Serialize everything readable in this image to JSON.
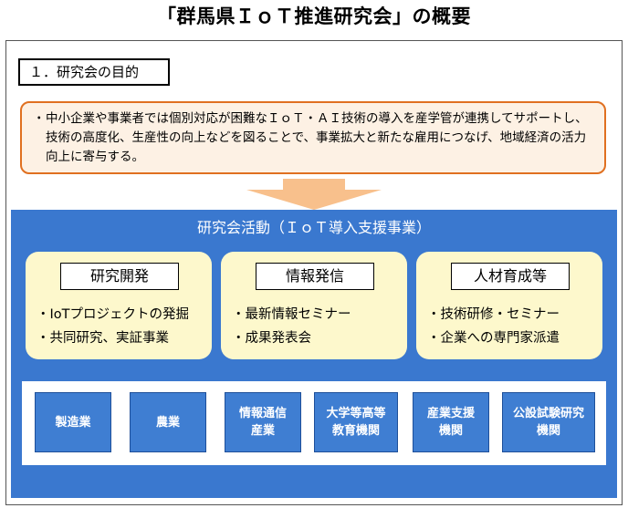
{
  "title": "「群馬県ＩｏＴ推進研究会」の概要",
  "section_label": "１．研究会の目的",
  "purpose": {
    "bullet": "・",
    "text": "中小企業や事業者では個別対応が困難なＩｏＴ・ＡＩ技術の導入を産学管が連携してサポートし、技術の高度化、生産性の向上などを図ることで、事業拡大と新たな雇用につなげ、地域経済の活力向上に寄与する。"
  },
  "activities": {
    "title": "研究会活動（ＩｏＴ導入支援事業）",
    "pillars": [
      {
        "title": "研究開発",
        "items": [
          "・IoTプロジェクトの発掘",
          "・共同研究、実証事業"
        ]
      },
      {
        "title": "情報発信",
        "items": [
          "・最新情報セミナー",
          "・成果発表会"
        ]
      },
      {
        "title": "人材育成等",
        "items": [
          "・技術研修・セミナー",
          "・企業への専門家派遣"
        ]
      }
    ],
    "sectors": [
      "製造業",
      "農業",
      "情報通信\n産業",
      "大学等高等\n教育機関",
      "産業支援\n機関",
      "公設試験研究\n機関"
    ]
  },
  "colors": {
    "accent_orange": "#e07020",
    "purpose_fill": "#fdf1e4",
    "panel_blue": "#3a78cf",
    "pillar_fill": "#fdf8cc",
    "sector_blue": "#3f7ed2",
    "arrow_fill": "#f8c08c"
  }
}
